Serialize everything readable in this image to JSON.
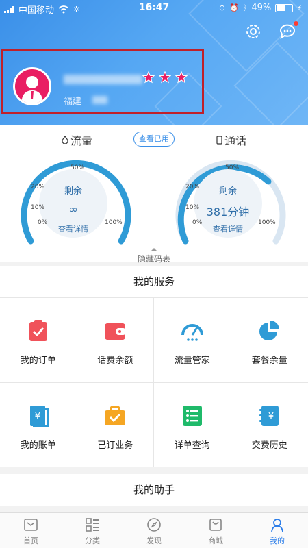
{
  "status_bar": {
    "carrier": "中国移动",
    "time": "16:47",
    "battery": "49%"
  },
  "profile": {
    "location_visible": "福建"
  },
  "usage": {
    "data_title": "流量",
    "call_title": "通话",
    "view_used_label": "查看已用",
    "data_gauge": {
      "remain_label": "剩余",
      "value": "∞",
      "detail_label": "查看详情",
      "ticks": [
        "0%",
        "10%",
        "20%",
        "50%",
        "100%"
      ]
    },
    "call_gauge": {
      "remain_label": "剩余",
      "value": "381分钟",
      "detail_label": "查看详情",
      "ticks": [
        "0%",
        "10%",
        "20%",
        "50%",
        "100%"
      ]
    },
    "hide_chart_label": "隐藏码表"
  },
  "services": {
    "title": "我的服务",
    "items": [
      {
        "label": "我的订单",
        "icon": "order-clipboard-icon",
        "color": "#f0525a"
      },
      {
        "label": "话费余额",
        "icon": "wallet-icon",
        "color": "#f0525a"
      },
      {
        "label": "流量管家",
        "icon": "speedometer-icon",
        "color": "#2f9bd6"
      },
      {
        "label": "套餐余量",
        "icon": "pie-chart-icon",
        "color": "#2f9bd6"
      },
      {
        "label": "我的账单",
        "icon": "bill-yen-icon",
        "color": "#2f9bd6"
      },
      {
        "label": "已订业务",
        "icon": "briefcase-icon",
        "color": "#f5a623"
      },
      {
        "label": "详单查询",
        "icon": "list-detail-icon",
        "color": "#1fba6a"
      },
      {
        "label": "交费历史",
        "icon": "payment-history-icon",
        "color": "#2f9bd6"
      }
    ]
  },
  "assistant": {
    "title": "我的助手"
  },
  "tabbar": {
    "tabs": [
      {
        "label": "首页",
        "icon": "home-icon"
      },
      {
        "label": "分类",
        "icon": "category-icon"
      },
      {
        "label": "发现",
        "icon": "compass-icon"
      },
      {
        "label": "商城",
        "icon": "mall-bag-icon"
      },
      {
        "label": "我的",
        "icon": "profile-icon",
        "active": true
      }
    ]
  },
  "colors": {
    "accent": "#3a8fe8",
    "gauge": "#2f9bd6",
    "highlight_box": "#c0202a",
    "tab_active": "#2b7de9"
  }
}
